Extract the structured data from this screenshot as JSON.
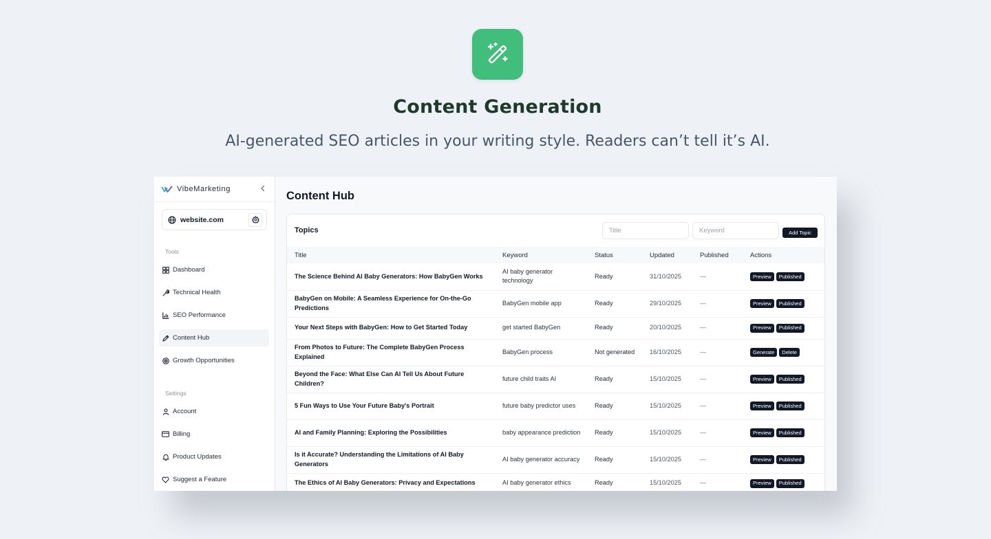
{
  "hero": {
    "title": "Content Generation",
    "subtitle": "AI-generated SEO articles in your writing style. Readers can’t tell it’s AI.",
    "icon": "magic-wand-icon",
    "icon_color": "#41bd7c"
  },
  "sidebar": {
    "brand": "VibeMarketing",
    "site": "website.com",
    "tools_label": "Tools",
    "tools": [
      {
        "label": "Dashboard",
        "icon": "grid-icon"
      },
      {
        "label": "Technical Health",
        "icon": "wrench-icon"
      },
      {
        "label": "SEO Performance",
        "icon": "bar-chart-icon"
      },
      {
        "label": "Content Hub",
        "icon": "pen-icon",
        "active": true
      },
      {
        "label": "Growth Opportunities",
        "icon": "target-icon"
      }
    ],
    "settings_label": "Settings",
    "settings": [
      {
        "label": "Account",
        "icon": "user-icon"
      },
      {
        "label": "Billing",
        "icon": "card-icon"
      },
      {
        "label": "Product Updates",
        "icon": "bell-icon"
      },
      {
        "label": "Suggest a Feature",
        "icon": "heart-icon"
      }
    ]
  },
  "main": {
    "page_title": "Content Hub",
    "topics": {
      "title": "Topics",
      "title_placeholder": "Title",
      "keyword_placeholder": "Keyword",
      "add_label": "Add Topic",
      "columns": [
        "Title",
        "Keyword",
        "Status",
        "Updated",
        "Published",
        "Actions"
      ],
      "rows": [
        {
          "title": "The Science Behind AI Baby Generators: How BabyGen Works",
          "keyword": "AI baby generator technology",
          "status": "Ready",
          "updated": "31/10/2025",
          "published": "—",
          "actions": [
            "Preview",
            "Published"
          ]
        },
        {
          "title": "BabyGen on Mobile: A Seamless Experience for On-the-Go Predictions",
          "keyword": "BabyGen mobile app",
          "status": "Ready",
          "updated": "29/10/2025",
          "published": "—",
          "actions": [
            "Preview",
            "Published"
          ]
        },
        {
          "title": "Your Next Steps with BabyGen: How to Get Started Today",
          "keyword": "get started BabyGen",
          "status": "Ready",
          "updated": "20/10/2025",
          "published": "—",
          "actions": [
            "Preview",
            "Published"
          ]
        },
        {
          "title": "From Photos to Future: The Complete BabyGen Process Explained",
          "keyword": "BabyGen process",
          "status": "Not generated",
          "updated": "16/10/2025",
          "published": "—",
          "actions": [
            "Generate",
            "Delete"
          ]
        },
        {
          "title": "Beyond the Face: What Else Can AI Tell Us About Future Children?",
          "keyword": "future child traits AI",
          "status": "Ready",
          "updated": "15/10/2025",
          "published": "—",
          "actions": [
            "Preview",
            "Published"
          ]
        },
        {
          "title": "5 Fun Ways to Use Your Future Baby's Portrait",
          "keyword": "future baby predictor uses",
          "status": "Ready",
          "updated": "15/10/2025",
          "published": "—",
          "actions": [
            "Preview",
            "Published"
          ]
        },
        {
          "title": "AI and Family Planning: Exploring the Possibilities",
          "keyword": "baby appearance prediction",
          "status": "Ready",
          "updated": "15/10/2025",
          "published": "—",
          "actions": [
            "Preview",
            "Published"
          ]
        },
        {
          "title": "Is it Accurate? Understanding the Limitations of AI Baby Generators",
          "keyword": "AI baby generator accuracy",
          "status": "Ready",
          "updated": "15/10/2025",
          "published": "—",
          "actions": [
            "Preview",
            "Published"
          ]
        },
        {
          "title": "The Ethics of AI Baby Generators: Privacy and Expectations",
          "keyword": "AI baby generator ethics",
          "status": "Ready",
          "updated": "15/10/2025",
          "published": "—",
          "actions": [
            "Preview",
            "Published"
          ]
        }
      ]
    }
  }
}
